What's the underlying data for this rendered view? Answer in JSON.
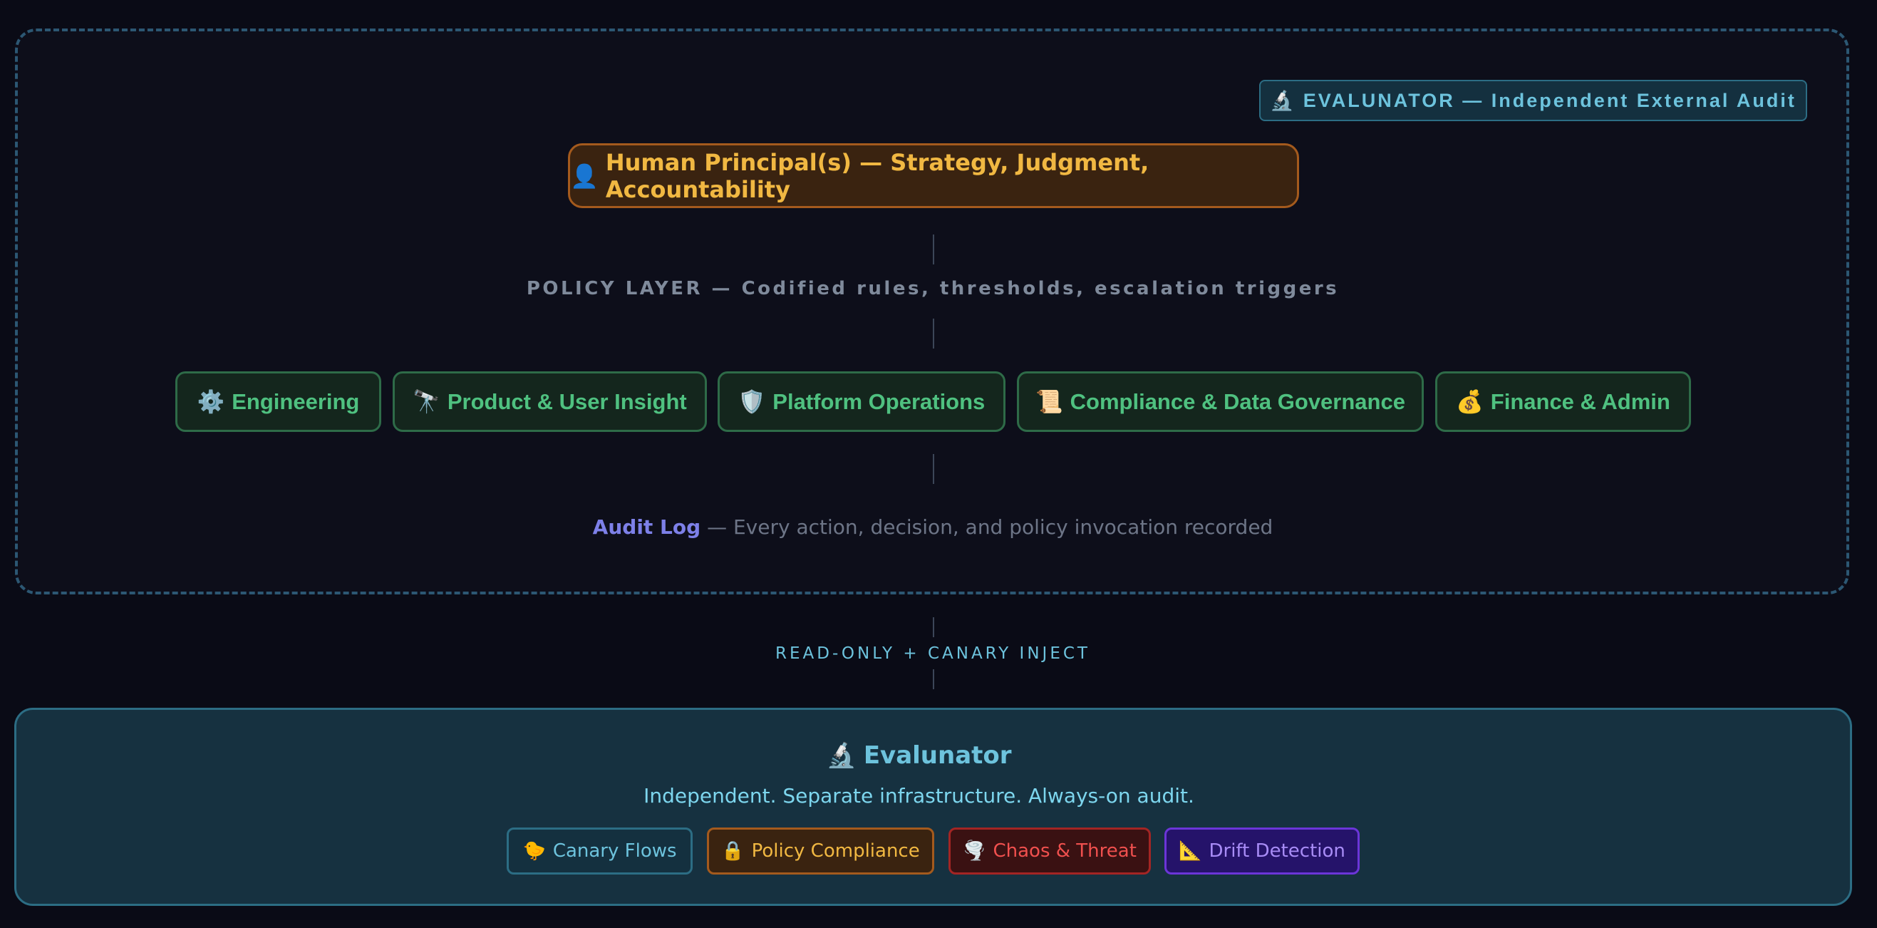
{
  "evaluator_badge": {
    "icon": "🔬",
    "label": "EVALUNATOR — Independent External Audit"
  },
  "principal": {
    "icon": "👤",
    "label": "Human Principal(s) — Strategy, Judgment, Accountability"
  },
  "policy_layer": "POLICY LAYER — Codified rules, thresholds, escalation triggers",
  "departments": [
    {
      "icon": "⚙️",
      "label": "Engineering"
    },
    {
      "icon": "🔭",
      "label": "Product & User Insight"
    },
    {
      "icon": "🛡️",
      "label": "Platform Operations"
    },
    {
      "icon": "📜",
      "label": "Compliance & Data Governance"
    },
    {
      "icon": "💰",
      "label": "Finance & Admin"
    }
  ],
  "audit_log": {
    "label": "Audit Log",
    "description": "— Every action, decision, and policy invocation recorded"
  },
  "connector_label": "READ-ONLY + CANARY INJECT",
  "evaluator": {
    "icon": "🔬",
    "title": "Evalunator",
    "subtitle": "Independent. Separate infrastructure. Always-on audit.",
    "tags": [
      {
        "icon": "🐤",
        "label": "Canary Flows",
        "color": "#6dc3dd"
      },
      {
        "icon": "🔒",
        "label": "Policy Compliance",
        "color": "#f1b842"
      },
      {
        "icon": "🌪️",
        "label": "Chaos & Threat",
        "color": "#f0504e"
      },
      {
        "icon": "📐",
        "label": "Drift Detection",
        "color": "#a88cf6"
      }
    ]
  }
}
